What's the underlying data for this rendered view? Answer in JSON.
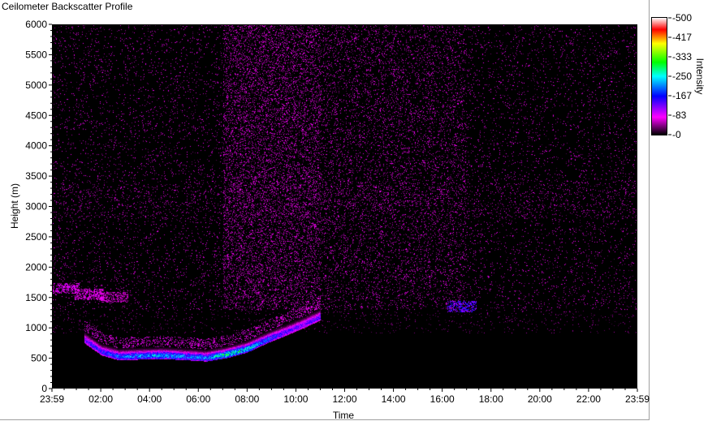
{
  "chart_data": {
    "type": "heatmap",
    "title": "Ceilometer Backscatter Profile",
    "xlabel": "Time",
    "ylabel": "Height (m)",
    "x_ticks": [
      "23:59",
      "02:00",
      "04:00",
      "06:00",
      "08:00",
      "10:00",
      "12:00",
      "14:00",
      "16:00",
      "18:00",
      "20:00",
      "22:00",
      "23:59"
    ],
    "y_ticks": [
      "0",
      "500",
      "1000",
      "1500",
      "2000",
      "2500",
      "3000",
      "3500",
      "4000",
      "4500",
      "5000",
      "5500",
      "6000"
    ],
    "ylim": [
      0,
      6000
    ],
    "xlim_hours": [
      0,
      24
    ],
    "colorbar": {
      "label": "Intensity",
      "ticks": [
        "-0",
        "-83",
        "-167",
        "-250",
        "-333",
        "-417",
        "-500"
      ],
      "range": [
        0,
        500
      ],
      "colors": [
        "#000000",
        "#ff00ff",
        "#0000ff",
        "#00ffff",
        "#00ff00",
        "#ffff00",
        "#ff0000",
        "#ffffff"
      ]
    },
    "features": {
      "cloud_layer": [
        {
          "hour": 1.3,
          "height": 800,
          "intensity": 140
        },
        {
          "hour": 2.0,
          "height": 600,
          "intensity": 180
        },
        {
          "hour": 2.7,
          "height": 520,
          "intensity": 200
        },
        {
          "hour": 3.5,
          "height": 530,
          "intensity": 220
        },
        {
          "hour": 4.5,
          "height": 540,
          "intensity": 240
        },
        {
          "hour": 5.5,
          "height": 520,
          "intensity": 220
        },
        {
          "hour": 6.3,
          "height": 500,
          "intensity": 220
        },
        {
          "hour": 7.2,
          "height": 560,
          "intensity": 290
        },
        {
          "hour": 8.0,
          "height": 650,
          "intensity": 260
        },
        {
          "hour": 8.8,
          "height": 800,
          "intensity": 200
        },
        {
          "hour": 9.6,
          "height": 930,
          "intensity": 150
        },
        {
          "hour": 10.3,
          "height": 1050,
          "intensity": 140
        },
        {
          "hour": 11.0,
          "height": 1180,
          "intensity": 160
        }
      ],
      "upper_layer": [
        {
          "hour": 0.5,
          "height": 1650,
          "intensity": 100
        },
        {
          "hour": 1.5,
          "height": 1550,
          "intensity": 90
        },
        {
          "hour": 2.5,
          "height": 1500,
          "intensity": 80
        },
        {
          "hour": 16.8,
          "height": 1350,
          "intensity": 180
        }
      ],
      "noise_region_hours": [
        7,
        11
      ],
      "noise_max_height": 6000
    }
  }
}
